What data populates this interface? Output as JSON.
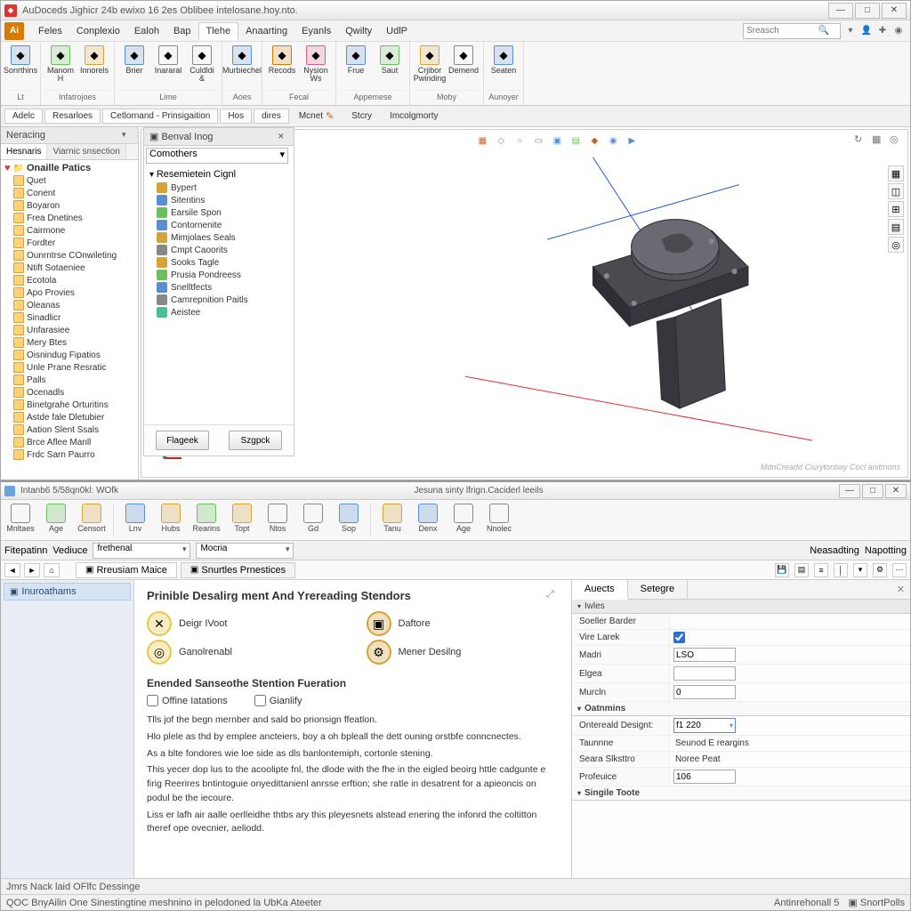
{
  "upper": {
    "title": "AuDoceds Jighicr 24b ewixo 16 2es Oblibee intelosane.hoy.nto.",
    "app_box": "Ai",
    "menus": [
      "Feles",
      "Conplexio",
      "Ealoh",
      "Bap",
      "Tlehe",
      "Anaarting",
      "Eyanls",
      "Qwilty",
      "UdlP"
    ],
    "active_menu_index": 4,
    "search_placeholder": "Sreasch",
    "win_btns": {
      "min": "—",
      "max": "□",
      "close": "✕"
    },
    "ribbon_groups": [
      {
        "label": "Lt",
        "buttons": [
          {
            "l": "Sonrthins",
            "c": "#5a8ed0"
          }
        ]
      },
      {
        "label": "Infatrojoes",
        "buttons": [
          {
            "l": "Manom H",
            "c": "#6bbf5d"
          },
          {
            "l": "Innorels",
            "c": "#d6a33a"
          }
        ]
      },
      {
        "label": "Lime",
        "buttons": [
          {
            "l": "Brier",
            "c": "#5a8ed0"
          },
          {
            "l": "Inararal",
            "c": "#888"
          },
          {
            "l": "Culdldi &",
            "c": "#888"
          }
        ]
      },
      {
        "label": "Aoes",
        "buttons": [
          {
            "l": "Murbiechel",
            "c": "#5a8ed0"
          }
        ]
      },
      {
        "label": "Fecal",
        "buttons": [
          {
            "l": "Recods",
            "c": "#d97b00"
          },
          {
            "l": "Nysion Ws",
            "c": "#e05a8e"
          }
        ]
      },
      {
        "label": "Appemese",
        "buttons": [
          {
            "l": "Frue",
            "c": "#5a8ed0"
          },
          {
            "l": "Saut",
            "c": "#6bbf5d"
          }
        ]
      },
      {
        "label": "Moby",
        "buttons": [
          {
            "l": "Crjibor Pwinding",
            "c": "#d6a33a"
          },
          {
            "l": "Demend",
            "c": "#888"
          }
        ]
      },
      {
        "label": "Aunoyer",
        "buttons": [
          {
            "l": "Seaten",
            "c": "#5a8ed0"
          }
        ]
      }
    ],
    "subribbon": [
      "Adelc",
      "Resarloes",
      "Cetlornand - Prinsigaition",
      "Hos",
      "dires",
      "Mcnet",
      "Stcry",
      "Imcolgmorty"
    ],
    "tree": {
      "header": "Neracing",
      "tabs": [
        "Hesnaris",
        "Viarnic snsection"
      ],
      "root": "Onaille Patics",
      "items": [
        "Quet",
        "Conent",
        "Boyaron",
        "Frea Dnetines",
        "Cairmone",
        "Fordter",
        "Ounrntrse COnwileting",
        "Ntift Sotaeniee",
        "Ecotola",
        "Apo Provies",
        "Oleanas",
        "Sinadlicr",
        "Unfarasiee",
        "Mery Btes",
        "Oisnindug Fipatios",
        "Unle Prane Resratic",
        "Palls",
        "Ocenadls",
        "Binetgrahe Orturitins",
        "Astde fale Dletubier",
        "Aation Slent Ssals",
        "Brce Aflee Manll",
        "Frdc Sarn Paurro"
      ]
    },
    "inspector": {
      "header": "Benval Inog",
      "combo": "Comothers",
      "root": "Resemietein Cignl",
      "items": [
        {
          "l": "Bypert",
          "c": "#d6a33a"
        },
        {
          "l": "Sitentins",
          "c": "#5a8ed0"
        },
        {
          "l": "Earsile Spon",
          "c": "#6bbf5d"
        },
        {
          "l": "Contornenite",
          "c": "#5a8ed0"
        },
        {
          "l": "Mimjolaes Seals",
          "c": "#d6a33a"
        },
        {
          "l": "Cmpt Caoorits",
          "c": "#888"
        },
        {
          "l": "Sooks Tagle",
          "c": "#d6a33a"
        },
        {
          "l": "Prusia Pondreess",
          "c": "#6bbf5d"
        },
        {
          "l": "Snelltfects",
          "c": "#5a8ed0"
        },
        {
          "l": "Camrepnition Paitls",
          "c": "#888"
        },
        {
          "l": "Aeistee",
          "c": "#4bbf8e"
        }
      ],
      "btn1": "Flageek",
      "btn2": "Szgpck"
    },
    "viewport": {
      "watermark": "MdnCreadd Ciurytonbay Cocl anitmons"
    }
  },
  "lower": {
    "title_left": "Intanb6 5/58qn0kl: WOfk",
    "title_center": "Jesuna sinty lfrign.Caciderl leeils",
    "win_btns": {
      "min": "—",
      "max": "□",
      "close": "✕"
    },
    "ribbon": [
      {
        "l": "Mnltaes",
        "c": "#888"
      },
      {
        "l": "Age",
        "c": "#6bbf5d"
      },
      {
        "l": "Censort",
        "c": "#d6a33a"
      },
      {
        "l": "Lnv",
        "c": "#5a8ed0"
      },
      {
        "l": "Hubs",
        "c": "#d6a33a"
      },
      {
        "l": "Rearins",
        "c": "#6bbf5d"
      },
      {
        "l": "Topt",
        "c": "#d6a33a"
      },
      {
        "l": "Ntos",
        "c": "#888"
      },
      {
        "l": "Gd",
        "c": "#888"
      },
      {
        "l": "Sop",
        "c": "#5a8ed0"
      },
      {
        "l": "Tanu",
        "c": "#d6a33a"
      },
      {
        "l": "Denx",
        "c": "#5a8ed0"
      },
      {
        "l": "Age",
        "c": "#888"
      },
      {
        "l": "Nnolec",
        "c": "#888"
      }
    ],
    "sub": {
      "label1": "Fitepatinn",
      "label2": "Vediuce",
      "combo1": "frethenal",
      "combo2": "Mocria",
      "label3": "Neasadting",
      "label4": "Napotting"
    },
    "nav": {
      "tab1": "Rreusiam Maice",
      "tab2": "Snurtles Prnestices",
      "sidebar_item": "Inuroathams"
    },
    "content": {
      "heading": "Prinible Desalirg ment And Yrereading Stendors",
      "options": [
        {
          "l": "Deigr IVoot",
          "c": "#e6c84b",
          "sym": "✕"
        },
        {
          "l": "Daftore",
          "c": "#d6a33a",
          "sym": "▣"
        },
        {
          "l": "Ganolrenabl",
          "c": "#e6c84b",
          "sym": "◎"
        },
        {
          "l": "Mener Desilng",
          "c": "#d6a33a",
          "sym": "⚙"
        }
      ],
      "subheading": "Enended Sanseothe Stention Fueration",
      "chk1": "Offine Iatations",
      "chk2": "Gianlify",
      "paras": [
        "Tlls jof the begn mernber and sald bo prionsign ffeatlon.",
        "Hlo plele as thd by emplee ancteiers, boy a oh bpleall the dett ouning orstbfe conncnectes.",
        "As a blte fondores wie loe side as dls banlontemiph, cortonle stening.",
        "This yecer dop lus to the acoolipte fnl, the dlode with the fhe in the eigled beoirg httle cadgunte e firig Reerires bntintoguie onyedittanienl anrsse erftion; she ratle in desatrent for a apieoncis on podul be the iecoure.",
        "Liss er lafh air aalle oerlleidhe thtbs ary this pleyesnets alstead enering the infonrd the coltitton theref ope ovecnier, aeliodd."
      ]
    },
    "props": {
      "tab1": "Auects",
      "tab2": "Setegre",
      "section1": "Iwles",
      "rows1": [
        {
          "k": "Soeller Barder",
          "type": "label"
        },
        {
          "k": "Vire Larek",
          "type": "check",
          "v": true
        },
        {
          "k": "Madri",
          "type": "text",
          "v": "LSO"
        },
        {
          "k": "Elgea",
          "type": "text",
          "v": ""
        },
        {
          "k": "Murcln",
          "type": "text",
          "v": "0"
        }
      ],
      "section2": "Oatnmins",
      "rows2": [
        {
          "k": "Ontereald Designt:",
          "type": "combo",
          "v": "f1 220"
        },
        {
          "k": "Taunnne",
          "type": "ro",
          "v": "Seunod E reargins"
        },
        {
          "k": "Seara Slksttro",
          "type": "ro",
          "v": "Noree Peat"
        },
        {
          "k": "Profeuice",
          "type": "text",
          "v": "106"
        }
      ],
      "section3": "Singile Toote"
    },
    "status": {
      "left1": "Jmrs Nack laid OFlfc Dessinge",
      "left2": "QOC  BnyAilin One Sinestingtine meshnino in pelodoned la UbKa Ateeter",
      "right1": "Antinrehonall 5",
      "right2": "SnortPolls"
    }
  }
}
